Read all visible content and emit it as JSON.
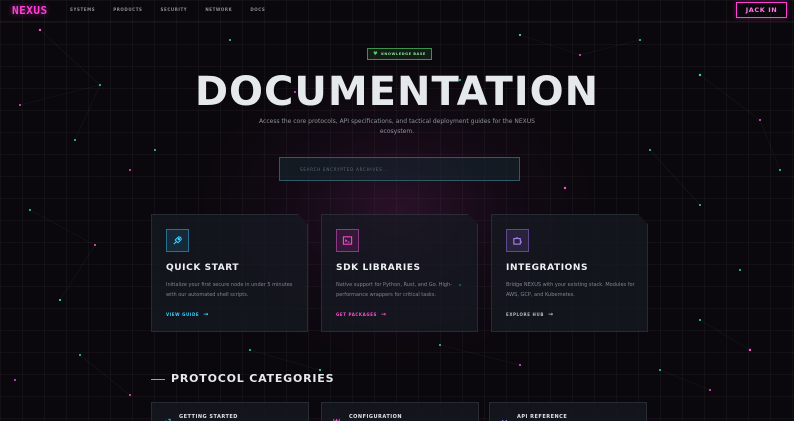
{
  "nav": {
    "logo": "NEXUS",
    "links": [
      "SYSTEMS",
      "PRODUCTS",
      "SECURITY",
      "NETWORK",
      "DOCS"
    ],
    "cta": "JACK IN"
  },
  "hero": {
    "badge": "KNOWLEDGE BASE",
    "title": "DOCUMENTATION",
    "subtitle": "Access the core protocols, API specifications, and tactical deployment guides for the NEXUS ecosystem.",
    "search_placeholder": "SEARCH ENCRYPTED ARCHIVES..."
  },
  "cards": [
    {
      "title": "QUICK START",
      "description": "Initialize your first secure node in under 5 minutes with our automated shell scripts.",
      "link": "VIEW GUIDE",
      "icon": "rocket-icon",
      "accent": "#3bd1ff"
    },
    {
      "title": "SDK LIBRARIES",
      "description": "Native support for Python, Rust, and Go. High-performance wrappers for critical tasks.",
      "link": "GET PACKAGES",
      "icon": "terminal-icon",
      "accent": "#ff4fd8"
    },
    {
      "title": "INTEGRATIONS",
      "description": "Bridge NEXUS with your existing stack. Modules for AWS, GCP, and Kubernetes.",
      "link": "EXPLORE HUB",
      "icon": "puzzle-icon",
      "accent": "#b58cff"
    }
  ],
  "section": {
    "title": "PROTOCOL CATEGORIES",
    "categories": [
      {
        "label": "GETTING STARTED",
        "icon": "entry-icon",
        "accent": "#3bd1ff"
      },
      {
        "label": "CONFIGURATION",
        "icon": "sliders-icon",
        "accent": "#ff4fd8"
      },
      {
        "label": "API REFERENCE",
        "icon": "code-icon",
        "accent": "#b58cff"
      }
    ]
  },
  "colors": {
    "background": "#0b080d",
    "logo": "#ff3fd8",
    "cyan": "#3bd1ff",
    "teal": "#2fd6c4",
    "magenta": "#ff4fd8",
    "violet": "#b58cff",
    "green": "#56d06a"
  }
}
